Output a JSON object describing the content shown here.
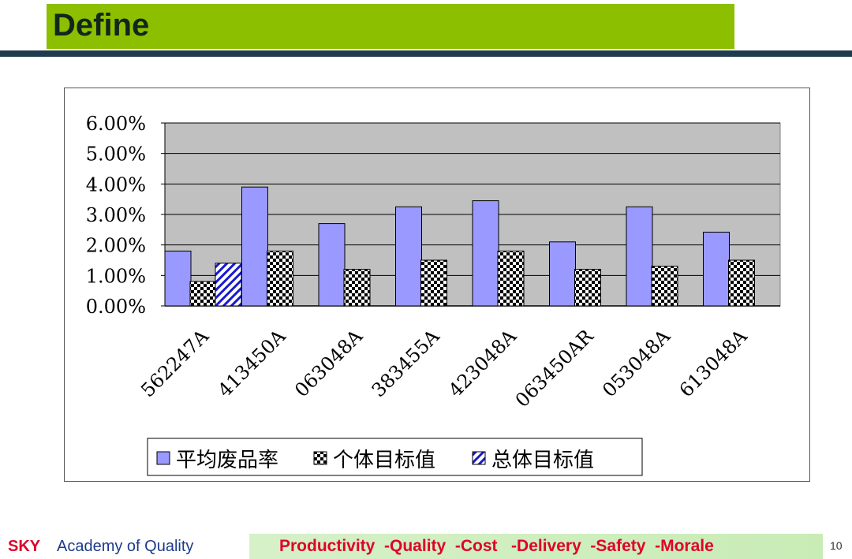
{
  "header": {
    "title": "Define"
  },
  "chart_data": {
    "type": "bar",
    "categories": [
      "562247A",
      "413450A",
      "063048A",
      "383455A",
      "423048A",
      "063450AR",
      "053048A",
      "613048A"
    ],
    "series": [
      {
        "name": "平均废品率",
        "values": [
          1.8,
          3.9,
          2.7,
          3.25,
          3.45,
          2.1,
          3.25,
          2.42
        ],
        "color": "#9999ff",
        "pattern": "solid"
      },
      {
        "name": "个体目标值",
        "values": [
          0.8,
          1.8,
          1.2,
          1.5,
          1.8,
          1.2,
          1.3,
          1.5
        ],
        "color": "#000000",
        "pattern": "checker"
      },
      {
        "name": "总体目标值",
        "values": [
          1.4,
          null,
          null,
          null,
          null,
          null,
          null,
          null
        ],
        "color": "#1a1acc",
        "pattern": "diagonal"
      }
    ],
    "y_ticks": [
      "0.00%",
      "1.00%",
      "2.00%",
      "3.00%",
      "4.00%",
      "5.00%",
      "6.00%"
    ],
    "ylim": [
      0,
      6
    ],
    "grid": true,
    "legend_position": "bottom"
  },
  "footer": {
    "brand": "SKY",
    "academy": "Academy of Quality",
    "slogan": "Productivity  -Quality  -Cost   -Delivery  -Safety  -Morale",
    "page_number": "10"
  }
}
